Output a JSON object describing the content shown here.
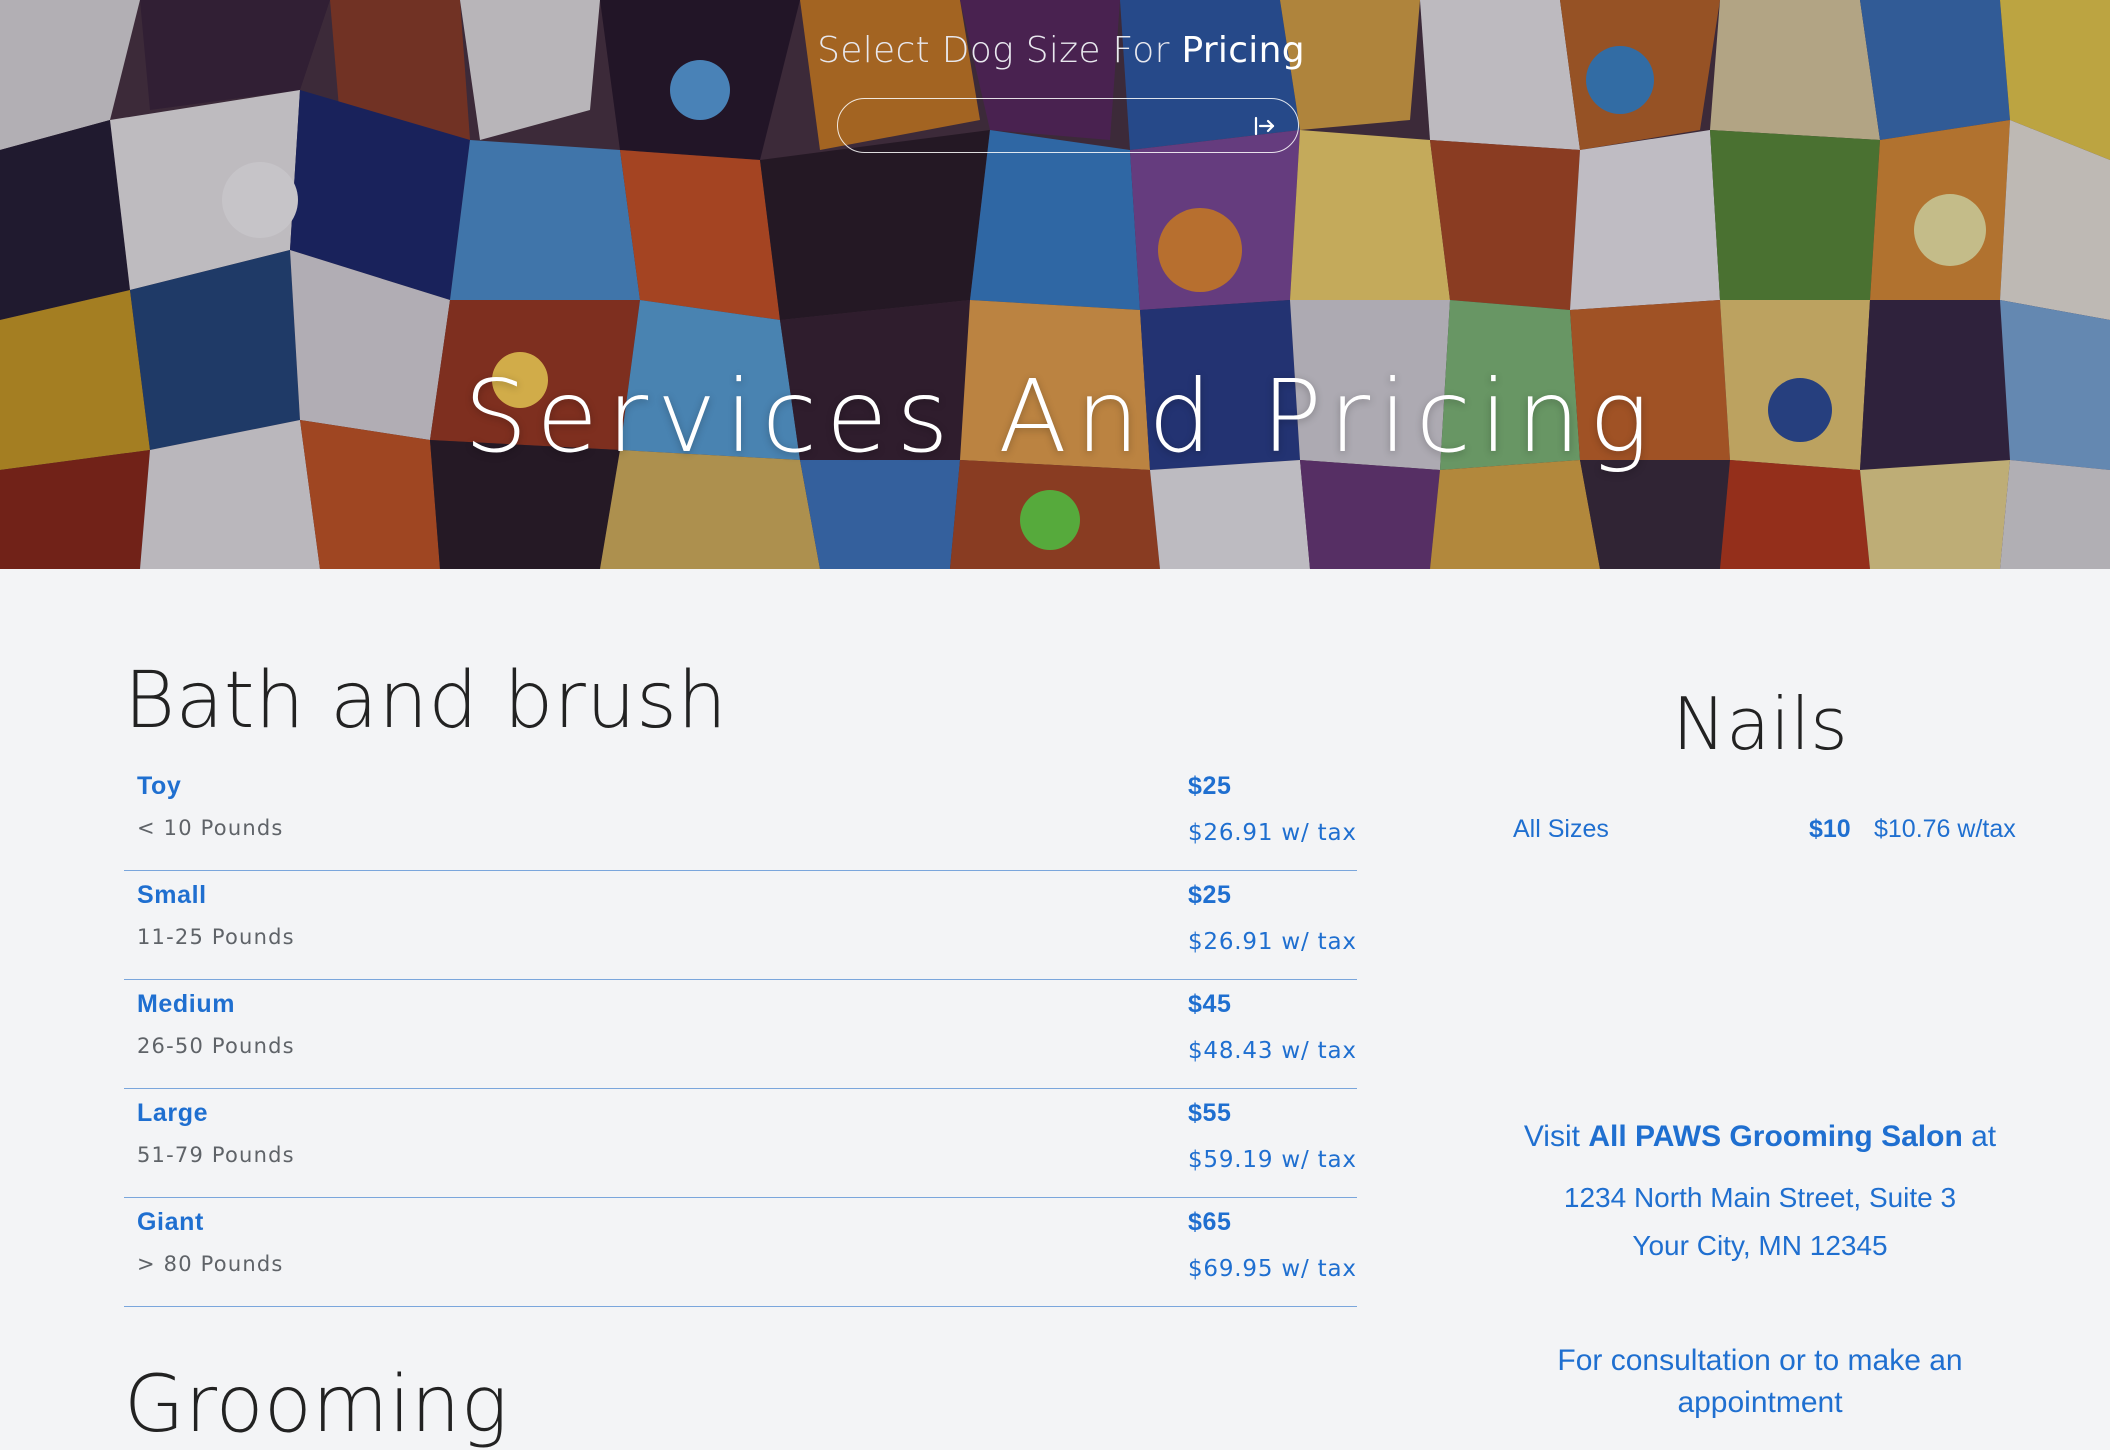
{
  "hero": {
    "selector_title_prefix": "Select Dog Size For ",
    "selector_title_strong": "Pricing",
    "size_select": {
      "value": ""
    },
    "title": "Services And Pricing"
  },
  "bath_and_brush": {
    "title": "Bath and brush",
    "rows": [
      {
        "name": "Toy",
        "weight": "< 10 Pounds",
        "price": "$25",
        "tax_price": "$26.91 w/ tax"
      },
      {
        "name": "Small",
        "weight": "11-25 Pounds",
        "price": "$25",
        "tax_price": "$26.91 w/ tax"
      },
      {
        "name": "Medium",
        "weight": "26-50 Pounds",
        "price": "$45",
        "tax_price": "$48.43 w/ tax"
      },
      {
        "name": "Large",
        "weight": "51-79 Pounds",
        "price": "$55",
        "tax_price": "$59.19 w/ tax"
      },
      {
        "name": "Giant",
        "weight": "> 80 Pounds",
        "price": "$65",
        "tax_price": "$69.95 w/ tax"
      }
    ]
  },
  "grooming": {
    "title": "Grooming"
  },
  "nails": {
    "title": "Nails",
    "size": "All Sizes",
    "price": "$10",
    "tax_price": "$10.76 w/tax"
  },
  "contact": {
    "visit_prefix": "Visit ",
    "salon_name": "All PAWS Grooming Salon",
    "visit_suffix": " at",
    "address_line1": "1234 North Main Street, Suite 3",
    "address_line2": "Your City, MN 12345",
    "consult_text": "For consultation or to make an appointment"
  },
  "colors": {
    "accent": "#1f6fd0",
    "divider": "#7aa6dc",
    "background": "#f3f4f6"
  },
  "icons": {
    "submit": "arrow-right-from-bar-icon"
  }
}
